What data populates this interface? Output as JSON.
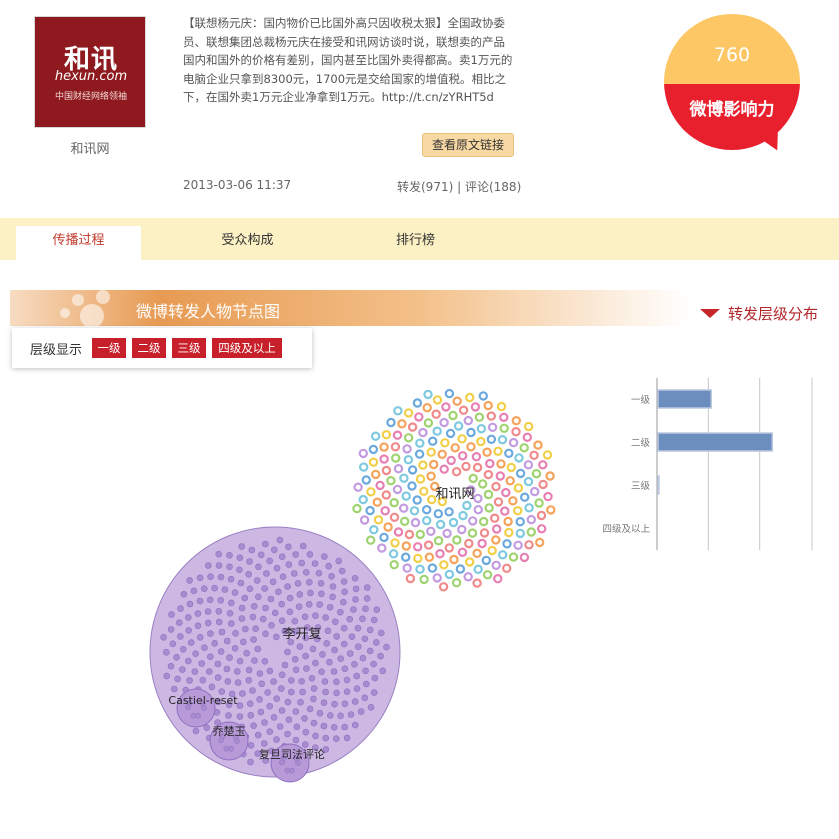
{
  "author": {
    "name": "和讯网",
    "logo_main": "和讯",
    "logo_sub": "hexun.com",
    "logo_tagline": "中国财经网络领袖"
  },
  "post": {
    "text": "【联想杨元庆：国内物价已比国外高只因收税太狠】全国政协委员、联想集团总裁杨元庆在接受和讯网访谈时说，联想卖的产品国内和国外的价格有差别，国内甚至比国外卖得都高。卖1万元的电脑企业只拿到8300元，1700元是交给国家的增值税。相比之下，在国外卖1万元企业净拿到1万元。http://t.cn/zYRHT5d",
    "original_link_label": "查看原文链接",
    "date": "2013-03-06 11:37",
    "reposts": "转发(971)",
    "separator": "|",
    "comments": "评论(188)"
  },
  "influence": {
    "value": "760",
    "label": "微博影响力",
    "top_color": "#fdc766",
    "bottom_color": "#e8202e"
  },
  "tabs": [
    {
      "label": "传播过程",
      "active": true
    },
    {
      "label": "受众构成",
      "active": false
    },
    {
      "label": "排行榜",
      "active": false
    }
  ],
  "section": {
    "title": "微博转发人物节点图",
    "level_dist_label": "转发层级分布"
  },
  "level_filter": {
    "label": "层级显示",
    "buttons": [
      "一级",
      "二级",
      "三级",
      "四级及以上"
    ]
  },
  "network": {
    "main_node": "和讯网",
    "hub_node": "李开复",
    "sub_nodes": [
      "Castiel-reset",
      "乔楚玉",
      "复旦司法评论"
    ],
    "main_dot_colors": [
      "#c39be0",
      "#f2cf4a",
      "#f08a8a",
      "#7ec9df",
      "#f5a25a",
      "#9fd36f",
      "#6aa8dd",
      "#e77fb3"
    ],
    "hub_fill": "#cdb8e4",
    "hub_dot_color": "#a98bd0"
  },
  "chart_data": {
    "type": "bar",
    "orientation": "horizontal",
    "categories": [
      "一级",
      "二级",
      "三级",
      "四级及以上"
    ],
    "values": [
      55,
      118,
      1,
      0
    ],
    "xlim": [
      0,
      160
    ],
    "grid": true,
    "bar_color": "#6c8ebf"
  }
}
